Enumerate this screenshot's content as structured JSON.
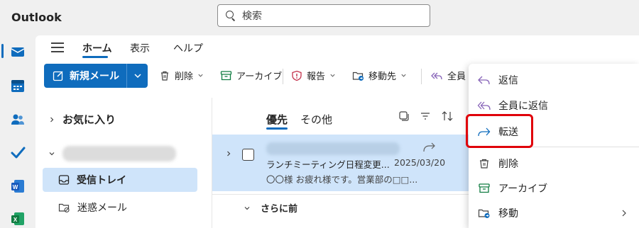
{
  "app": {
    "title": "Outlook"
  },
  "search": {
    "placeholder": "検索"
  },
  "rail": {
    "items": [
      "mail-icon",
      "calendar-icon",
      "people-icon",
      "todo-icon",
      "word-icon",
      "excel-icon"
    ]
  },
  "ribbon": {
    "tabs": [
      {
        "label": "ホーム",
        "active": true
      },
      {
        "label": "表示",
        "active": false
      },
      {
        "label": "ヘルプ",
        "active": false
      }
    ],
    "toolbar": {
      "new_mail": "新規メール",
      "delete": "削除",
      "archive": "アーカイブ",
      "report": "報告",
      "move": "移動先",
      "reply_all": "全員"
    }
  },
  "folders": {
    "favorites": "お気に入り",
    "items": [
      {
        "label": "受信トレイ",
        "selected": true
      },
      {
        "label": "迷惑メール",
        "selected": false
      }
    ]
  },
  "list": {
    "tabs": [
      {
        "label": "優先",
        "active": true
      },
      {
        "label": "その他",
        "active": false
      }
    ],
    "message": {
      "subject": "ランチミーティング日程変更...",
      "date": "2025/03/20",
      "preview": "〇〇様 お疲れ様です。営業部の□□..."
    },
    "group_header": "さらに前"
  },
  "context_menu": {
    "items": [
      {
        "label": "返信",
        "icon": "reply-icon"
      },
      {
        "label": "全員に返信",
        "icon": "reply-all-icon"
      },
      {
        "label": "転送",
        "icon": "forward-icon",
        "highlighted": true
      },
      {
        "label": "削除",
        "icon": "delete-icon"
      },
      {
        "label": "アーカイブ",
        "icon": "archive-icon"
      },
      {
        "label": "移動",
        "icon": "move-icon"
      }
    ]
  },
  "colors": {
    "accent": "#0f6cbd",
    "selected_bg": "#cfe4fa",
    "highlight_border": "#e0000a"
  }
}
